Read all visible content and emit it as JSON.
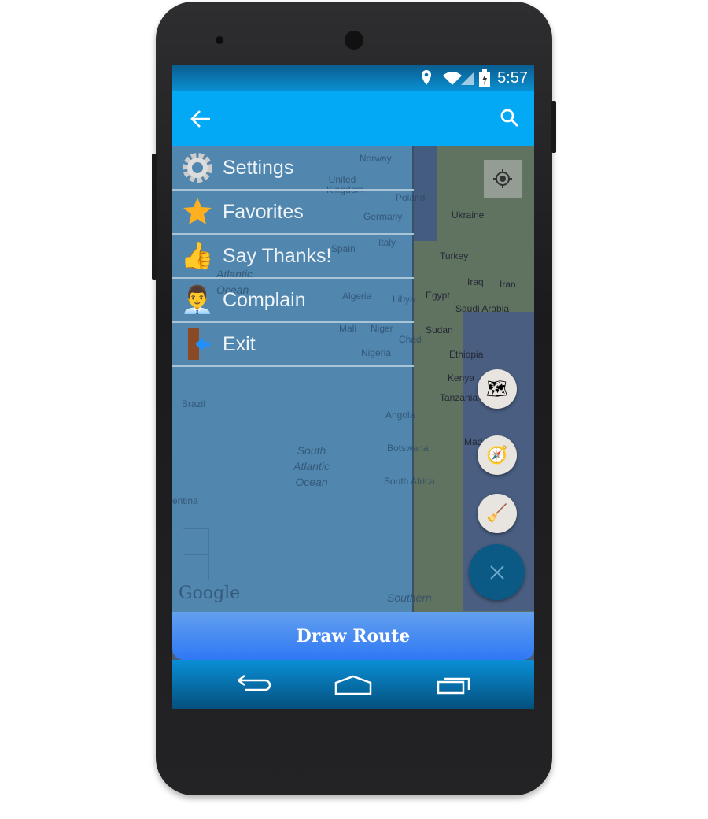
{
  "status_bar": {
    "time": "5:57",
    "icons": [
      "location-pin-icon",
      "wifi-icon",
      "signal-icon",
      "battery-charging-icon"
    ]
  },
  "app_bar": {
    "back_icon": "arrow-left-icon",
    "search_icon": "search-icon"
  },
  "drawer": {
    "items": [
      {
        "label": "Settings",
        "icon": "gear-icon"
      },
      {
        "label": "Favorites",
        "icon": "star-icon"
      },
      {
        "label": "Say Thanks!",
        "icon": "thumbs-up-icon"
      },
      {
        "label": "Complain",
        "icon": "support-agent-icon"
      },
      {
        "label": "Exit",
        "icon": "exit-door-icon"
      }
    ]
  },
  "map": {
    "labels": [
      "Norway",
      "United Kingdom",
      "Poland",
      "Germany",
      "Ukraine",
      "Spain",
      "Italy",
      "Turkey",
      "Atlantic Ocean",
      "Iraq",
      "Iran",
      "Algeria",
      "Libya",
      "Egypt",
      "Saudi Arabia",
      "Mali",
      "Niger",
      "Sudan",
      "Chad",
      "Nigeria",
      "Ethiopia",
      "Kenya",
      "Brazil",
      "Tanzania",
      "Angola",
      "South Atlantic Ocean",
      "Botswana",
      "Mad",
      "South Africa",
      "entina",
      "Southern",
      "Google"
    ]
  },
  "fabs": [
    "layers-icon",
    "compass-icon",
    "broom-icon",
    "close-icon"
  ],
  "draw_route": {
    "label": "Draw Route"
  },
  "nav_bar": [
    "back-nav-icon",
    "home-nav-icon",
    "recents-nav-icon"
  ],
  "colors": {
    "app_bar": "#03a9f4",
    "draw_button": "#3d86f3",
    "fab_main": "#0a5a85"
  }
}
